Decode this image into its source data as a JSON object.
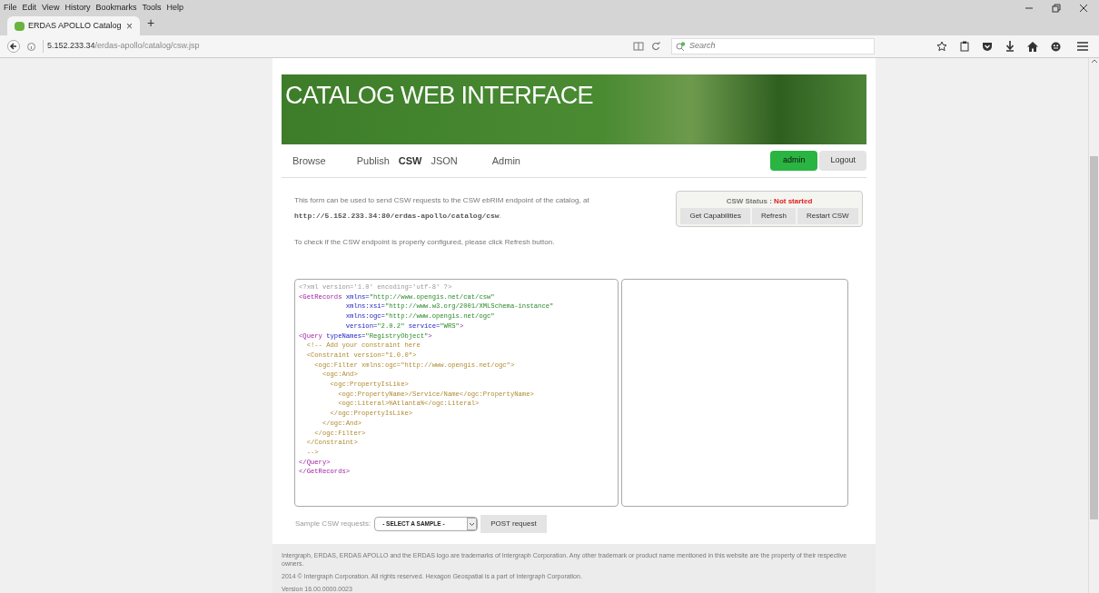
{
  "menu_bar": [
    "File",
    "Edit",
    "View",
    "History",
    "Bookmarks",
    "Tools",
    "Help"
  ],
  "tab": {
    "title": "ERDAS APOLLO Catalog",
    "close": "×",
    "new_tab": "+"
  },
  "address_bar": {
    "host": "5.152.233.34",
    "path": "/erdas-apollo/catalog/csw.jsp"
  },
  "search": {
    "placeholder": "Search"
  },
  "banner": {
    "title": "CATALOG WEB INTERFACE"
  },
  "nav": [
    {
      "label": "Browse",
      "selected": false
    },
    {
      "label": "Publish",
      "selected": false
    },
    {
      "label": "CSW",
      "selected": true
    },
    {
      "label": "JSON",
      "selected": false
    },
    {
      "label": "Admin",
      "selected": false
    }
  ],
  "user": {
    "name": "admin",
    "logout": "Logout"
  },
  "intro": {
    "text": "This form can be used to send CSW requests to the CSW ebRIM endpoint of the catalog, at",
    "url": "http://5.152.233.34:80/erdas-apollo/catalog/csw",
    "url_suffix": ".",
    "hint": "To check if the CSW endpoint is properly configured, please click Refresh button."
  },
  "csw_status": {
    "label": "CSW Status :",
    "value": "Not started",
    "buttons": [
      "Get Capabilities",
      "Refresh",
      "Restart CSW"
    ]
  },
  "request_editor": {
    "lines": [
      [
        {
          "kind": "decl",
          "text": "<?xml version='1.0' encoding='utf-8' ?>"
        }
      ],
      [
        {
          "kind": "tag",
          "text": "<GetRecords "
        },
        {
          "kind": "attr",
          "text": "xmlns="
        },
        {
          "kind": "value",
          "text": "\"http://www.opengis.net/cat/csw\""
        }
      ],
      [
        {
          "kind": "attr",
          "text": "            xmlns:xsi="
        },
        {
          "kind": "value",
          "text": "\"http://www.w3.org/2001/XMLSchema-instance\""
        }
      ],
      [
        {
          "kind": "attr",
          "text": "            xmlns:ogc="
        },
        {
          "kind": "value",
          "text": "\"http://www.opengis.net/ogc\""
        }
      ],
      [
        {
          "kind": "attr",
          "text": "            version="
        },
        {
          "kind": "value",
          "text": "\"2.0.2\" "
        },
        {
          "kind": "attr",
          "text": "service="
        },
        {
          "kind": "value",
          "text": "\"WRS\""
        },
        {
          "kind": "tag",
          "text": ">"
        }
      ],
      [
        {
          "kind": "tag",
          "text": "<Query "
        },
        {
          "kind": "attr",
          "text": "typeNames="
        },
        {
          "kind": "value",
          "text": "\"RegistryObject\""
        },
        {
          "kind": "tag",
          "text": ">"
        }
      ],
      [
        {
          "kind": "comment",
          "text": "  <!-- Add your constraint here"
        }
      ],
      [
        {
          "kind": "comment",
          "text": "  <Constraint version=\"1.0.0\">"
        }
      ],
      [
        {
          "kind": "comment",
          "text": "    <ogc:Filter xmlns:ogc=\"http://www.opengis.net/ogc\">"
        }
      ],
      [
        {
          "kind": "comment",
          "text": "      <ogc:And>"
        }
      ],
      [
        {
          "kind": "comment",
          "text": "        <ogc:PropertyIsLike>"
        }
      ],
      [
        {
          "kind": "comment",
          "text": "          <ogc:PropertyName>/Service/Name</ogc:PropertyName>"
        }
      ],
      [
        {
          "kind": "comment",
          "text": "          <ogc:Literal>%Atlanta%</ogc:Literal>"
        }
      ],
      [
        {
          "kind": "comment",
          "text": "        </ogc:PropertyIsLike>"
        }
      ],
      [
        {
          "kind": "comment",
          "text": "      </ogc:And>"
        }
      ],
      [
        {
          "kind": "comment",
          "text": "    </ogc:Filter>"
        }
      ],
      [
        {
          "kind": "comment",
          "text": "  </Constraint>"
        }
      ],
      [
        {
          "kind": "comment",
          "text": "  -->"
        }
      ],
      [
        {
          "kind": "tag",
          "text": "</Query>"
        }
      ],
      [
        {
          "kind": "tag",
          "text": "</GetRecords>"
        }
      ]
    ]
  },
  "sample": {
    "label": "Sample CSW requests:",
    "select": "- SELECT A SAMPLE -",
    "button": "POST request"
  },
  "footer": [
    "Intergraph, ERDAS, ERDAS APOLLO and the ERDAS logo are trademarks of Intergraph Corporation. Any other trademark or product name mentioned in this website are the property of their respective owners.",
    "2014 © Intergraph Corporation. All rights reserved. Hexagon Geospatial is a part of Intergraph Corporation.",
    "Version 16.00.0000.0023"
  ]
}
